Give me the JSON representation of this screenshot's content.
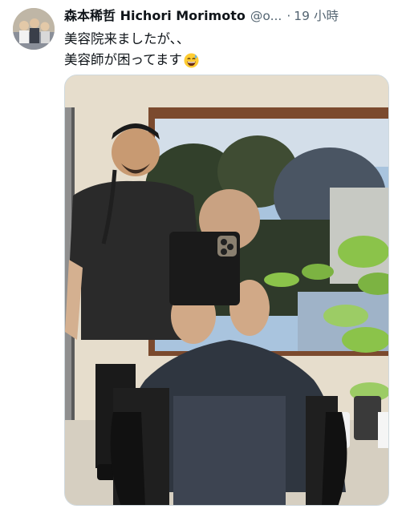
{
  "tweet": {
    "author": {
      "display_name": "森本稀哲 Hichori Morimoto",
      "handle": "@o...",
      "separator": "·",
      "time": "19 小時"
    },
    "text_lines": [
      "美容院来ましたが、、",
      "美容師が困ってます"
    ],
    "emoji": "grinning-face-with-sweat",
    "colors": {
      "text": "#0f1419",
      "secondary": "#536471",
      "border": "#cfd9de"
    }
  }
}
